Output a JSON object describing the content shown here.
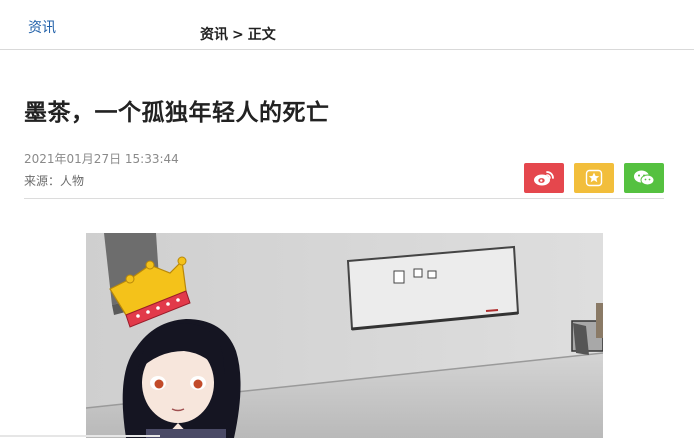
{
  "header": {
    "nav_link": "资讯",
    "breadcrumb": {
      "section": "资讯",
      "separator": ">",
      "current": "正文"
    }
  },
  "article": {
    "title": "墨茶，一个孤独年轻人的死亡",
    "datetime": "2021年01月27日 15:33:44",
    "source_label": "来源：",
    "source_name": "人物"
  },
  "share": {
    "weibo_icon": "weibo-icon",
    "favorite_icon": "star-icon",
    "wechat_icon": "wechat-icon"
  },
  "colors": {
    "link": "#1f5fa8",
    "weibo": "#e5474d",
    "favorite": "#f2be3b",
    "wechat": "#55c140"
  }
}
